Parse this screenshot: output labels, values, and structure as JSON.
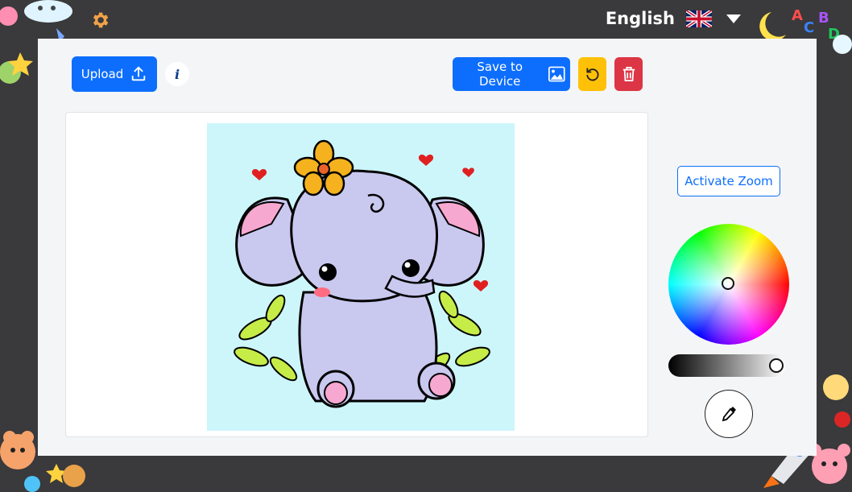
{
  "header": {
    "language": "English",
    "flag": "uk-flag-icon",
    "settings_icon": "gear-icon"
  },
  "toolbar": {
    "upload_label": "Upload",
    "info_label": "i",
    "save_label": "Save to Device",
    "colors": {
      "primary": "#0d6efd",
      "reset": "#ffc107",
      "delete": "#dc3545"
    }
  },
  "side": {
    "zoom_label": "Activate Zoom"
  },
  "canvas": {
    "background": "#cdf6fb",
    "image": "baby-elephant-with-flower-coloring-picture"
  },
  "color_picker": {
    "brightness": 1.0
  }
}
